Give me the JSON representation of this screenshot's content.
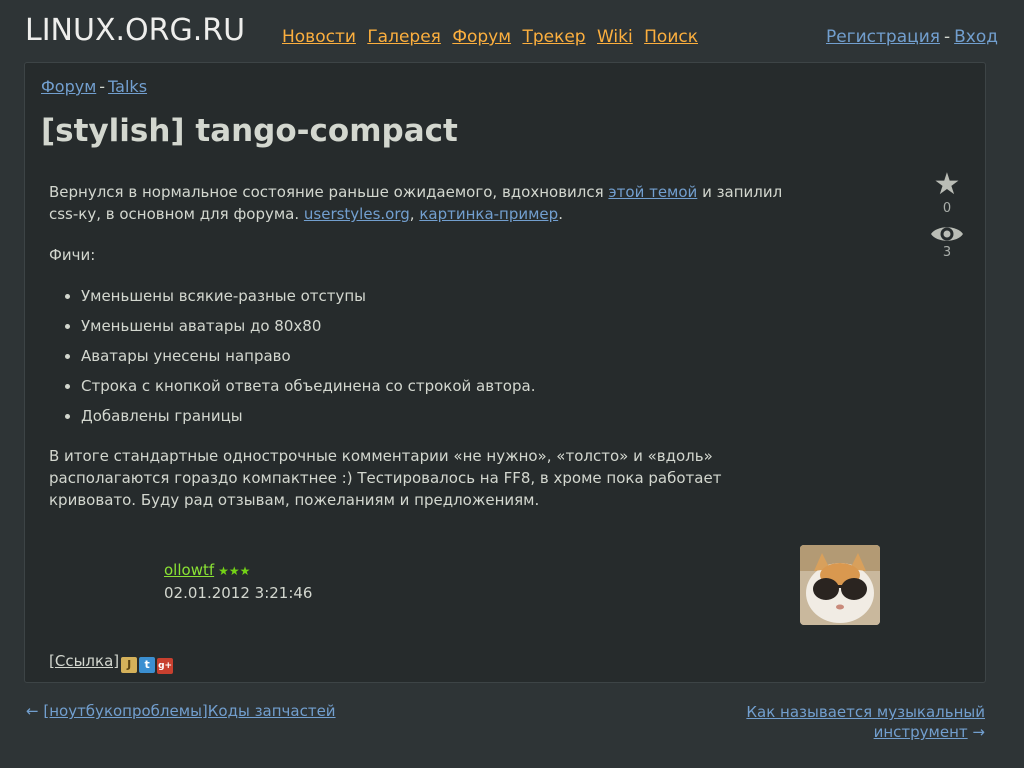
{
  "header": {
    "logo": "LINUX.ORG.RU",
    "nav": [
      "Новости",
      "Галерея",
      "Форум",
      "Трекер",
      "Wiki",
      "Поиск"
    ],
    "register": "Регистрация",
    "separator": "-",
    "login": "Вход"
  },
  "breadcrumb": {
    "forum": "Форум",
    "dash": "-",
    "section": "Talks"
  },
  "topic": {
    "title": "[stylish] tango-compact",
    "intro_1": "Вернулся в нормальное состояние раньше ожидаемого, вдохновился ",
    "intro_link_1": "этой темой",
    "intro_2": " и запилил css-ку, в основном для форума. ",
    "intro_link_2": "userstyles.org",
    "intro_comma": ", ",
    "intro_link_3": "картинка-пример",
    "intro_end": ".",
    "features_label": "Фичи:",
    "features": [
      "Уменьшены всякие-разные отступы",
      "Уменьшены аватары до 80x80",
      "Аватары унесены направо",
      "Строка с кнопкой ответа объединена со строкой автора.",
      "Добавлены границы"
    ],
    "outro": "В итоге стандартные однострочные комментарии «не нужно», «толсто» и «вдоль» располагаются гораздо компактнее :) Тестировалось на FF8, в хроме пока работает кривовато. Буду рад отзывам, пожеланиям и предложениям."
  },
  "stats": {
    "favorites": "0",
    "watchers": "3",
    "icons": [
      "star-icon",
      "eye-icon"
    ]
  },
  "author": {
    "nick": "ollowtf",
    "stars": "★★★",
    "date": "02.01.2012 3:21:46"
  },
  "links": {
    "permalink": "[Ссылка]",
    "share_icons": [
      "juick-icon",
      "twitter-icon",
      "google-plus-icon"
    ]
  },
  "pagination": {
    "prev_arrow": "←",
    "prev": "[ноутбукопроблемы]Коды запчастей",
    "next": "Как называется музыкальный инструмент",
    "next_arrow": "→"
  },
  "colors": {
    "background": "#2e3436",
    "card": "#262b2c",
    "link": "#729fcf",
    "nav_link": "#fcaf3e",
    "author": "#8ae234"
  }
}
